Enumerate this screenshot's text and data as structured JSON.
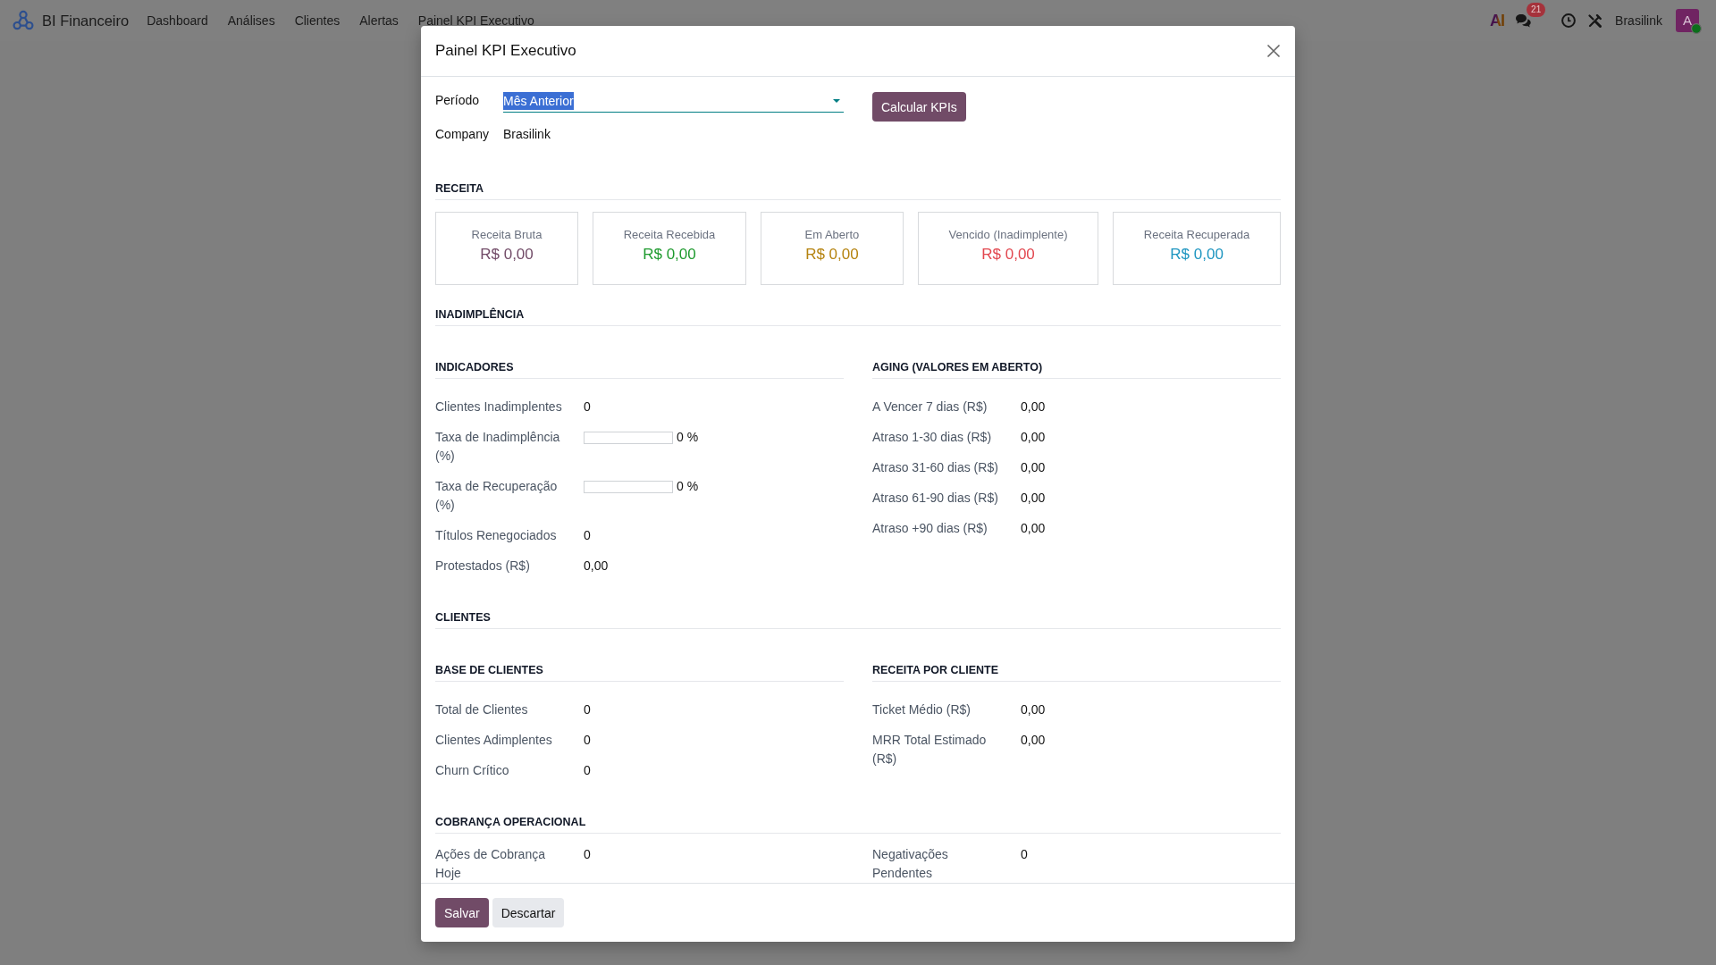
{
  "navbar": {
    "app_name": "BI Financeiro",
    "menu": [
      "Dashboard",
      "Análises",
      "Clientes",
      "Alertas",
      "Painel KPI Executivo"
    ],
    "ai_label": "AI",
    "chat_badge": "21",
    "company": "Brasilink",
    "avatar": {
      "initial": "A",
      "online": true
    }
  },
  "dialog": {
    "title": "Painel KPI Executivo",
    "fields": [
      {
        "kind": "select",
        "label": "Período",
        "value": "Mês Anterior",
        "highlighted": true
      },
      {
        "kind": "text",
        "label": "Company",
        "value": "Brasilink"
      }
    ],
    "action_button": "Calcular KPIs",
    "sections": [
      {
        "kind": "cards",
        "title": "RECEITA",
        "cards": [
          {
            "label": "Receita Bruta",
            "value": "R$ 0,00",
            "color": "#714b67"
          },
          {
            "label": "Receita Recebida",
            "value": "R$ 0,00",
            "color": "#1e9a2e"
          },
          {
            "label": "Em Aberto",
            "value": "R$ 0,00",
            "color": "#b5830f"
          },
          {
            "label": "Vencido (Inadimplente)",
            "value": "R$ 0,00",
            "color": "#e2474f"
          },
          {
            "label": "Receita Recuperada",
            "value": "R$ 0,00",
            "color": "#1d95c0"
          }
        ]
      },
      {
        "kind": "groups",
        "title": "INADIMPLÊNCIA",
        "groups": [
          {
            "title": "INDICADORES",
            "rows": [
              {
                "kind": "value",
                "label": "Clientes Inadimplentes",
                "value": "0"
              },
              {
                "kind": "progress",
                "label": "Taxa de Inadimplência (%)",
                "level": 0,
                "reading": "0 %"
              },
              {
                "kind": "progress",
                "label": "Taxa de Recuperação (%)",
                "level": 0,
                "reading": "0 %"
              },
              {
                "kind": "value",
                "label": "Títulos Renegociados",
                "value": "0"
              },
              {
                "kind": "value",
                "label": "Protestados (R$)",
                "value": "0,00"
              }
            ]
          },
          {
            "title": "AGING (VALORES EM ABERTO)",
            "rows": [
              {
                "kind": "value",
                "label": "A Vencer 7 dias (R$)",
                "value": "0,00"
              },
              {
                "kind": "value",
                "label": "Atraso 1-30 dias (R$)",
                "value": "0,00"
              },
              {
                "kind": "value",
                "label": "Atraso 31-60 dias (R$)",
                "value": "0,00"
              },
              {
                "kind": "value",
                "label": "Atraso 61-90 dias (R$)",
                "value": "0,00"
              },
              {
                "kind": "value",
                "label": "Atraso +90 dias (R$)",
                "value": "0,00"
              }
            ]
          }
        ]
      },
      {
        "kind": "groups",
        "title": "CLIENTES",
        "groups": [
          {
            "title": "BASE DE CLIENTES",
            "rows": [
              {
                "kind": "value",
                "label": "Total de Clientes",
                "value": "0"
              },
              {
                "kind": "value",
                "label": "Clientes Adimplentes",
                "value": "0"
              },
              {
                "kind": "value",
                "label": "Churn Crítico",
                "value": "0"
              }
            ]
          },
          {
            "title": "RECEITA POR CLIENTE",
            "rows": [
              {
                "kind": "value",
                "label": "Ticket Médio (R$)",
                "value": "0,00"
              },
              {
                "kind": "value",
                "label": "MRR Total Estimado (R$)",
                "value": "0,00"
              }
            ]
          }
        ]
      },
      {
        "kind": "groups",
        "title": "COBRANÇA OPERACIONAL",
        "groups": [
          {
            "rows": [
              {
                "kind": "value",
                "label": "Ações de Cobrança Hoje",
                "value": "0"
              }
            ]
          },
          {
            "rows": [
              {
                "kind": "value",
                "label": "Negativações Pendentes",
                "value": "0"
              }
            ]
          }
        ]
      }
    ],
    "footer_buttons": [
      {
        "kind": "primary",
        "label": "Salvar"
      },
      {
        "kind": "secondary",
        "label": "Descartar"
      }
    ]
  }
}
